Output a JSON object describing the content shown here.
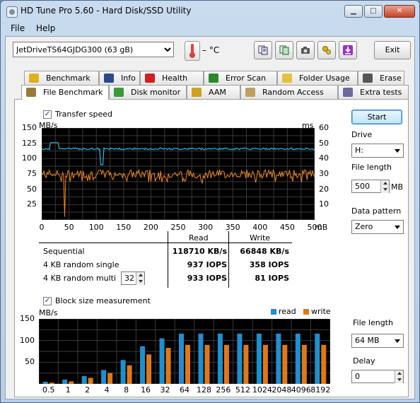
{
  "window": {
    "title": "HD Tune Pro 5.60 - Hard Disk/SSD Utility"
  },
  "menu": [
    "File",
    "Help"
  ],
  "toolbar": {
    "drive": "JetDriveTS64GJDG300 (63 gB)",
    "temperature": "– °C",
    "exit_label": "Exit",
    "buttons": [
      "copy-info-icon",
      "copy-text-icon",
      "camera-icon",
      "tools-icon",
      "save-icon"
    ]
  },
  "tabs_row1": [
    {
      "label": "Benchmark",
      "icon": "benchmark-icon"
    },
    {
      "label": "Info",
      "icon": "info-icon"
    },
    {
      "label": "Health",
      "icon": "health-icon"
    },
    {
      "label": "Error Scan",
      "icon": "magnifier-icon"
    },
    {
      "label": "Folder Usage",
      "icon": "folder-icon"
    },
    {
      "label": "Erase",
      "icon": "trash-icon"
    }
  ],
  "tabs_row2": [
    {
      "label": "File Benchmark",
      "icon": "file-benchmark-icon",
      "active": true
    },
    {
      "label": "Disk monitor",
      "icon": "disk-monitor-icon"
    },
    {
      "label": "AAM",
      "icon": "speaker-icon"
    },
    {
      "label": "Random Access",
      "icon": "random-access-icon"
    },
    {
      "label": "Extra tests",
      "icon": "extra-tests-icon"
    }
  ],
  "transfer": {
    "checkbox_label": "Transfer speed",
    "checked": true,
    "left_unit": "MB/s",
    "right_unit": "ms",
    "x_unit": "mB",
    "y_ticks_left": [
      "150",
      "125",
      "100",
      "75",
      "50",
      "25"
    ],
    "y_ticks_right": [
      "60",
      "50",
      "40",
      "30",
      "20",
      "10"
    ],
    "x_ticks": [
      "0",
      "50",
      "100",
      "150",
      "200",
      "250",
      "300",
      "350",
      "400",
      "450",
      "500"
    ]
  },
  "results": {
    "read_header": "Read",
    "write_header": "Write",
    "rows": [
      {
        "label": "Sequential",
        "read": "118710 KB/s",
        "write": "66848 KB/s"
      },
      {
        "label": "4 KB random single",
        "read": "937 IOPS",
        "write": "358 IOPS"
      },
      {
        "label": "4 KB random multi",
        "read": "933 IOPS",
        "write": "81 IOPS"
      }
    ],
    "queue_depth": "32"
  },
  "controls": {
    "start_label": "Start",
    "drive_label": "Drive",
    "drive_value": "H:",
    "file_length_label": "File length",
    "file_length_value": "500",
    "file_length_unit": "MB",
    "data_pattern_label": "Data pattern",
    "data_pattern_value": "Zero"
  },
  "block": {
    "checkbox_label": "Block size measurement",
    "checked": true,
    "file_length_label": "File length",
    "file_length_value": "64 MB",
    "delay_label": "Delay",
    "delay_value": "0"
  },
  "chart_data": [
    {
      "type": "line",
      "name": "transfer-speed",
      "xlabel": "mB",
      "ylabel": "MB/s",
      "y2label": "ms",
      "xlim": [
        0,
        500
      ],
      "ylim": [
        0,
        150
      ],
      "y2lim": [
        0,
        60
      ],
      "grid": true,
      "read_line": {
        "color": "#2fb7e6",
        "typical": 116,
        "peak": 126,
        "dip_at": 110,
        "dip_to": 90
      },
      "write_line": {
        "color": "#f08a20",
        "typical": 75,
        "low": 60,
        "spike_at": 42,
        "spike_to": 5
      }
    },
    {
      "type": "bar",
      "name": "block-size",
      "ylabel": "MB/s",
      "ylim": [
        0,
        150
      ],
      "y_ticks": [
        "150",
        "100",
        "50"
      ],
      "grid": true,
      "legend_position": "top-right",
      "categories": [
        "0.5",
        "1",
        "2",
        "4",
        "8",
        "16",
        "32",
        "64",
        "128",
        "256",
        "512",
        "1024",
        "2048",
        "4096",
        "8192"
      ],
      "series": [
        {
          "name": "read",
          "color": "#1e8fd0",
          "values": [
            5,
            10,
            18,
            32,
            55,
            87,
            105,
            116,
            116,
            116,
            116,
            116,
            116,
            116,
            116
          ]
        },
        {
          "name": "write",
          "color": "#e07818",
          "values": [
            3,
            6,
            14,
            25,
            43,
            68,
            83,
            90,
            90,
            90,
            90,
            90,
            90,
            90,
            90
          ]
        }
      ],
      "legend": [
        "read",
        "write"
      ]
    }
  ]
}
